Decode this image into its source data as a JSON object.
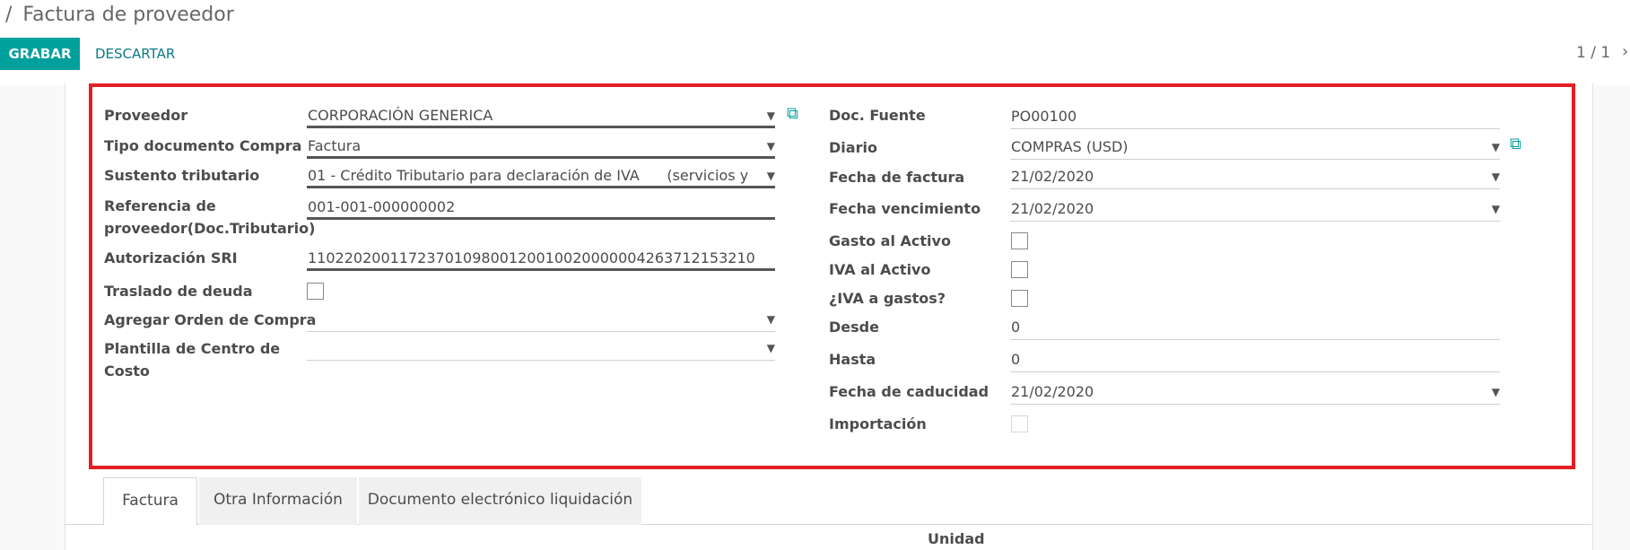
{
  "breadcrumb": {
    "separator": "/",
    "title": "Factura de proveedor"
  },
  "toolbar": {
    "save_label": "GRABAR",
    "discard_label": "DESCARTAR"
  },
  "pager": {
    "text": "1 / 1"
  },
  "left_fields": {
    "proveedor": {
      "label": "Proveedor",
      "value": "CORPORACIÓN GENERICA"
    },
    "tipo_documento": {
      "label": "Tipo documento Compra",
      "value": "Factura"
    },
    "sustento": {
      "label": "Sustento tributario",
      "value": "01 - Crédito Tributario para declaración de IVA      (servicios y"
    },
    "referencia": {
      "label_line1": "Referencia de",
      "label_line2": "proveedor(Doc.Tributario)",
      "value": "001-001-000000002"
    },
    "autorizacion": {
      "label": "Autorización SRI",
      "value": "1102202001172370109800120010020000004263712153210"
    },
    "traslado": {
      "label": "Traslado de deuda"
    },
    "orden_compra": {
      "label": "Agregar Orden de Compra",
      "value": ""
    },
    "plantilla": {
      "label_line1": "Plantilla de Centro de",
      "label_line2": "Costo",
      "value": ""
    }
  },
  "right_fields": {
    "doc_fuente": {
      "label": "Doc. Fuente",
      "value": "PO00100"
    },
    "diario": {
      "label": "Diario",
      "value": "COMPRAS (USD)"
    },
    "fecha_factura": {
      "label": "Fecha de factura",
      "value": "21/02/2020"
    },
    "fecha_vencimiento": {
      "label": "Fecha vencimiento",
      "value": "21/02/2020"
    },
    "gasto_activo": {
      "label": "Gasto al Activo"
    },
    "iva_activo": {
      "label": "IVA al Activo"
    },
    "iva_gastos": {
      "label": "¿IVA a gastos?"
    },
    "desde": {
      "label": "Desde",
      "value": "0"
    },
    "hasta": {
      "label": "Hasta",
      "value": "0"
    },
    "fecha_caducidad": {
      "label": "Fecha de caducidad",
      "value": "21/02/2020"
    },
    "importacion": {
      "label": "Importación"
    }
  },
  "tabs": [
    {
      "label": "Factura"
    },
    {
      "label": "Otra Información"
    },
    {
      "label": "Documento electrónico liquidación"
    }
  ],
  "table": {
    "partial_header": "Unidad"
  },
  "colors": {
    "accent": "#00A09D",
    "highlight": "#E31E24"
  },
  "icons": {
    "dropdown": "caret-down-icon",
    "external": "external-link-icon",
    "pager_next": "chevron-right-icon"
  }
}
